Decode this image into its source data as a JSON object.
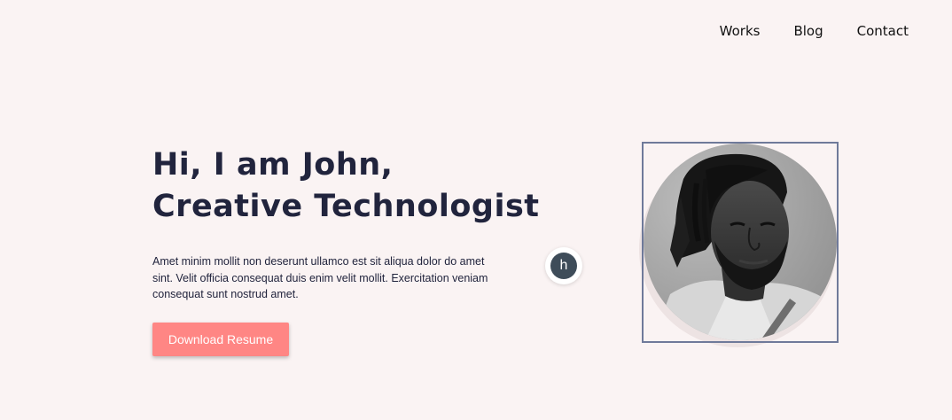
{
  "nav": {
    "items": [
      {
        "label": "Works"
      },
      {
        "label": "Blog"
      },
      {
        "label": "Contact"
      }
    ]
  },
  "hero": {
    "title_line1": "Hi, I am John,",
    "title_line2": "Creative Technologist",
    "description": "Amet minim mollit non deserunt ullamco est sit aliqua dolor do amet sint. Velit officia consequat duis enim velit mollit. Exercitation veniam consequat sunt nostrud amet.",
    "button_label": "Download Resume"
  },
  "floating_badge": {
    "letter": "h"
  },
  "colors": {
    "background": "#FAF3F3",
    "heading": "#21243D",
    "accent_button": "#FF8684",
    "badge": "#3E4C59",
    "frame": "#6F7A9A"
  }
}
